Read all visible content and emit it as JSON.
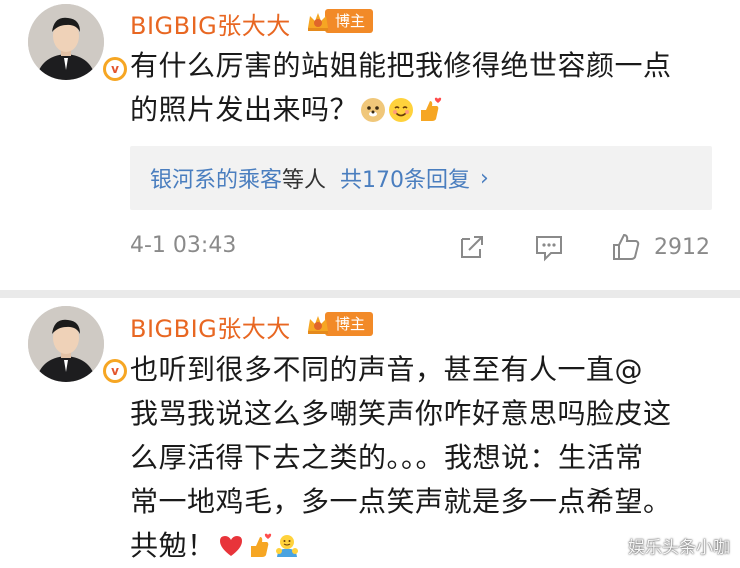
{
  "posts": [
    {
      "username": "BIGBIG张大大",
      "badge_label": "博主",
      "text_lines": [
        "有什么厉害的站姐能把我修得绝世容颜一点",
        "的照片发出来吗？"
      ],
      "emojis": [
        "doge-emoji",
        "smile-emoji",
        "thumbs-up-heart-emoji"
      ],
      "replies_link_name": "银河系的乘客",
      "replies_mid": "等人",
      "replies_count_text": "共170条回复",
      "timestamp": "4-1 03:43",
      "like_count": "2912"
    },
    {
      "username": "BIGBIG张大大",
      "badge_label": "博主",
      "text_lines": [
        "也听到很多不同的声音，甚至有人一直@",
        "我骂我说这么多嘲笑声你咋好意思吗脸皮这",
        "么厚活得下去之类的。。。我想说：生活常",
        "常一地鸡毛，多一点笑声就是多一点希望。",
        "共勉！"
      ],
      "emojis": [
        "red-heart-emoji",
        "thumbs-up-heart-emoji",
        "hug-emoji"
      ]
    }
  ],
  "watermark": "娱乐头条小咖",
  "colors": {
    "username": "#e86722",
    "badge": "#f28a28",
    "link": "#4a7ebf",
    "meta": "#8a8a8a"
  }
}
